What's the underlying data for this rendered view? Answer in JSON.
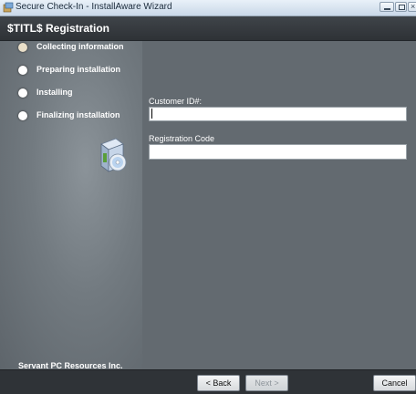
{
  "window": {
    "title": "Secure Check-In - InstallAware Wizard",
    "close_glyph": "×"
  },
  "header": {
    "title": "$TITL$ Registration"
  },
  "steps": [
    {
      "label": "Collecting information",
      "state": "current"
    },
    {
      "label": "Preparing installation",
      "state": "pending"
    },
    {
      "label": "Installing",
      "state": "pending"
    },
    {
      "label": "Finalizing installation",
      "state": "pending"
    }
  ],
  "company": "Servant PC Resources Inc.",
  "form": {
    "customer_id": {
      "label": "Customer ID#:",
      "value": ""
    },
    "registration_code": {
      "label": "Registration Code",
      "value": ""
    }
  },
  "buttons": {
    "back": "< Back",
    "next": "Next >",
    "cancel": "Cancel"
  },
  "icons": {
    "app": "installer-app-icon",
    "install": "software-box-disc-icon"
  }
}
